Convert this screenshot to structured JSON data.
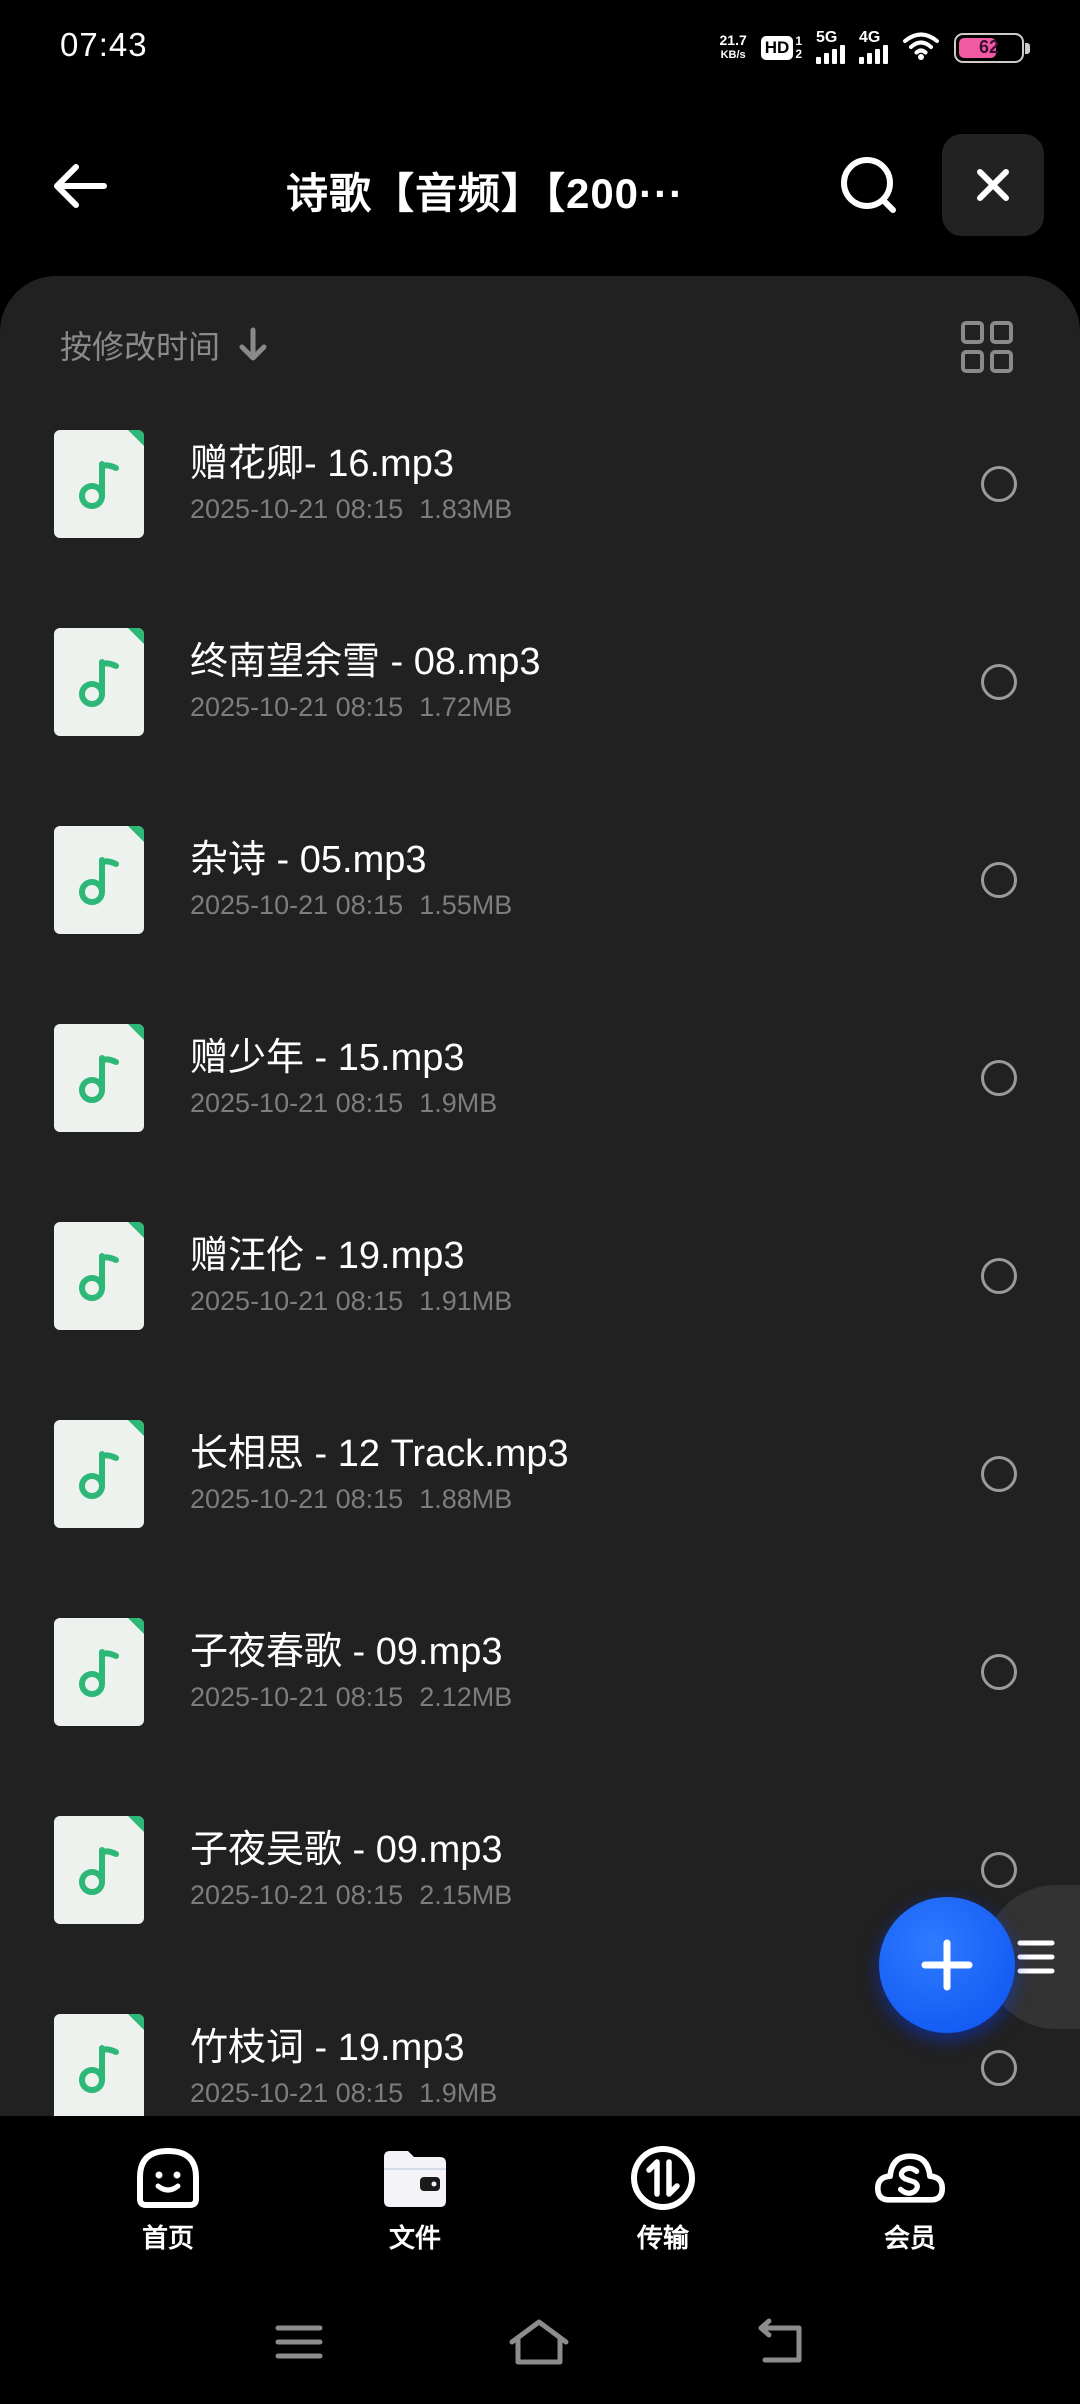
{
  "status_bar": {
    "time": "07:43",
    "net_speed_value": "21.7",
    "net_speed_unit": "KB/s",
    "hd": "HD",
    "hd_sub_top": "1",
    "hd_sub_bottom": "2",
    "sig1_label": "5G",
    "sig2_label": "4G",
    "battery": "62"
  },
  "header": {
    "title": "诗歌【音频】【200···"
  },
  "toolbar": {
    "sort_label": "按修改时间"
  },
  "files": [
    {
      "name": "赠花卿- 16.mp3",
      "date": "2025-10-21 08:15",
      "size": "1.83MB"
    },
    {
      "name": "终南望余雪 - 08.mp3",
      "date": "2025-10-21 08:15",
      "size": "1.72MB"
    },
    {
      "name": "杂诗 - 05.mp3",
      "date": "2025-10-21 08:15",
      "size": "1.55MB"
    },
    {
      "name": "赠少年 - 15.mp3",
      "date": "2025-10-21 08:15",
      "size": "1.9MB"
    },
    {
      "name": "赠汪伦 - 19.mp3",
      "date": "2025-10-21 08:15",
      "size": "1.91MB"
    },
    {
      "name": "长相思 - 12 Track.mp3",
      "date": "2025-10-21 08:15",
      "size": "1.88MB"
    },
    {
      "name": "子夜春歌 - 09.mp3",
      "date": "2025-10-21 08:15",
      "size": "2.12MB"
    },
    {
      "name": "子夜吴歌 - 09.mp3",
      "date": "2025-10-21 08:15",
      "size": "2.15MB"
    },
    {
      "name": "竹枝词 - 19.mp3",
      "date": "2025-10-21 08:15",
      "size": "1.9MB"
    }
  ],
  "bottom_nav": [
    {
      "label": "首页",
      "icon": "smile-face-icon"
    },
    {
      "label": "文件",
      "icon": "folder-icon"
    },
    {
      "label": "传输",
      "icon": "transfer-icon"
    },
    {
      "label": "会员",
      "icon": "cloud-member-icon"
    }
  ],
  "colors": {
    "background": "#000000",
    "panel": "#212121",
    "accent_green": "#2db877",
    "fab_blue": "#1764ff",
    "muted_text": "#7d7d7d"
  }
}
